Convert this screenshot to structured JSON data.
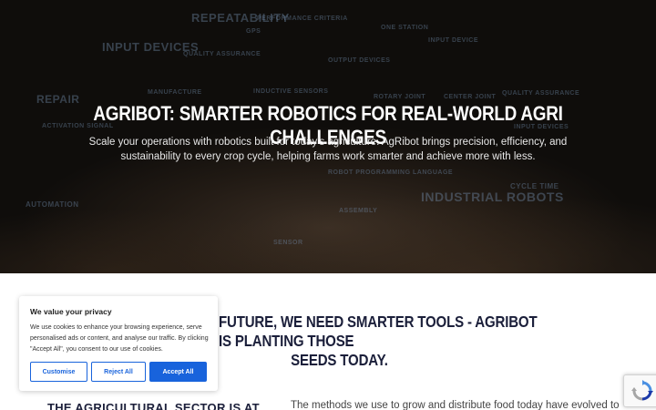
{
  "hero": {
    "title": "AGRIBOT: SMARTER ROBOTICS FOR REAL-WORLD AGRI CHALLENGES",
    "subtitle": "Scale your operations with robotics built for today's agriculture. AgRibot brings precision, efficiency, and sustainability to every crop cycle, helping farms work smarter and achieve more with less.",
    "background_words": [
      "REPEATABILITY",
      "PERFORMANCE CRITERIA",
      "INPUT DEVICES",
      "QUALITY ASSURANCE",
      "OUTPUT DEVICES",
      "REPAIR",
      "MANUFACTURE",
      "INDUCTIVE SENSORS",
      "ROTARY JOINT",
      "CENTER JOINT",
      "QUALITY ASSURANCE",
      "ACTIVATION SIGNAL",
      "INPUT DEVICES",
      "CYCLE TIME",
      "INDUSTRIAL ROBOTS",
      "GPS",
      "ONE STATION",
      "INPUT DEVICE",
      "ROBOT PROGRAMMING LANGUAGE",
      "AUTOMATION",
      "ASSEMBLY",
      "SENSOR"
    ]
  },
  "section": {
    "heading_line1": "FUTURE, WE NEED SMARTER TOOLS - AGRIBOT IS PLANTING THOSE",
    "heading_line2": "SEEDS TODAY.",
    "left_heading": "THE AGRICULTURAL SECTOR IS AT A CRITICAL",
    "body": "The methods we use to grow and distribute food today have evolved to"
  },
  "cookie_banner": {
    "title": "We value your privacy",
    "text": "We use cookies to enhance your browsing experience, serve personalised ads or content, and analyse our traffic. By clicking \"Accept All\", you consent to our use of cookies.",
    "customise": "Customise",
    "reject": "Reject All",
    "accept": "Accept All",
    "accent_color": "#1863dc"
  },
  "recaptcha": {
    "icon": "recaptcha-icon"
  }
}
